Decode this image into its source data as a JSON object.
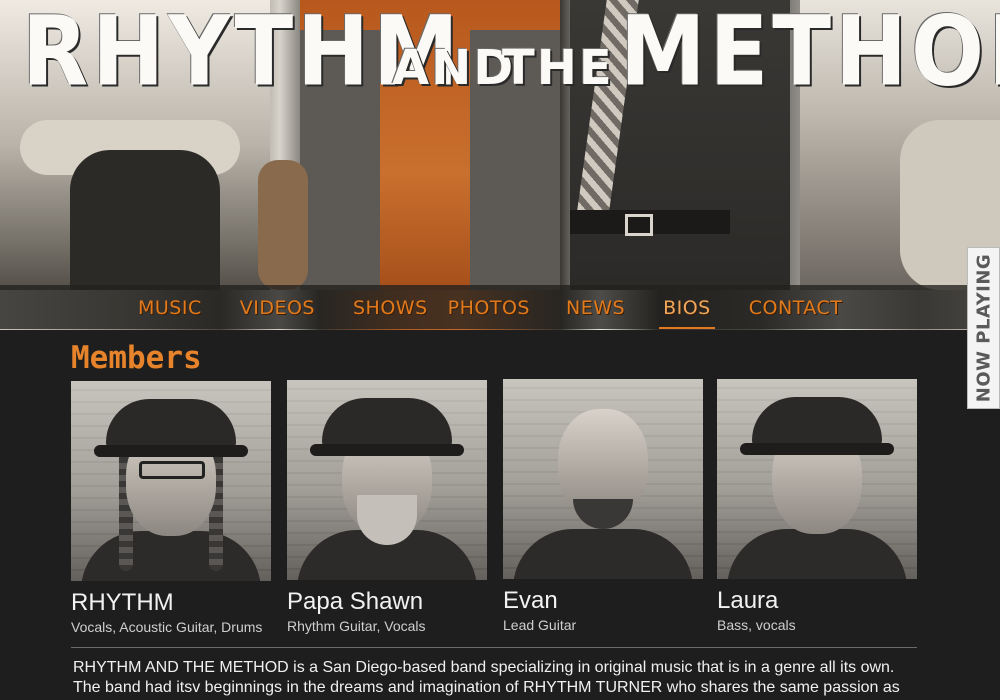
{
  "header": {
    "title_part1": "RHYTHM",
    "title_part2": "AND",
    "title_part3": "THE",
    "title_part4": "METHOD"
  },
  "nav": {
    "items": [
      {
        "label": "MUSIC"
      },
      {
        "label": "VIDEOS"
      },
      {
        "label": "SHOWS"
      },
      {
        "label": "PHOTOS"
      },
      {
        "label": "NEWS"
      },
      {
        "label": "BIOS",
        "active": true
      },
      {
        "label": "CONTACT"
      }
    ]
  },
  "now_playing": {
    "label": "NOW PLAYING"
  },
  "members": {
    "heading": "Members",
    "list": [
      {
        "name": "RHYTHM",
        "role": "Vocals, Acoustic Guitar, Drums"
      },
      {
        "name": "Papa Shawn",
        "role": "Rhythm Guitar, Vocals"
      },
      {
        "name": "Evan",
        "role": "Lead Guitar"
      },
      {
        "name": "Laura",
        "role": "Bass, vocals"
      }
    ]
  },
  "bio": {
    "line1": "RHYTHM AND THE METHOD is a San Diego-based band specializing in original music that is in a genre all its own.",
    "line2": "The band had itsv beginnings in the dreams and imagination of RHYTHM TURNER who shares the same passion as"
  },
  "colors": {
    "accent": "#e6832b",
    "nav_text": "#e07a1c",
    "page_bg": "#1e1e1e"
  }
}
